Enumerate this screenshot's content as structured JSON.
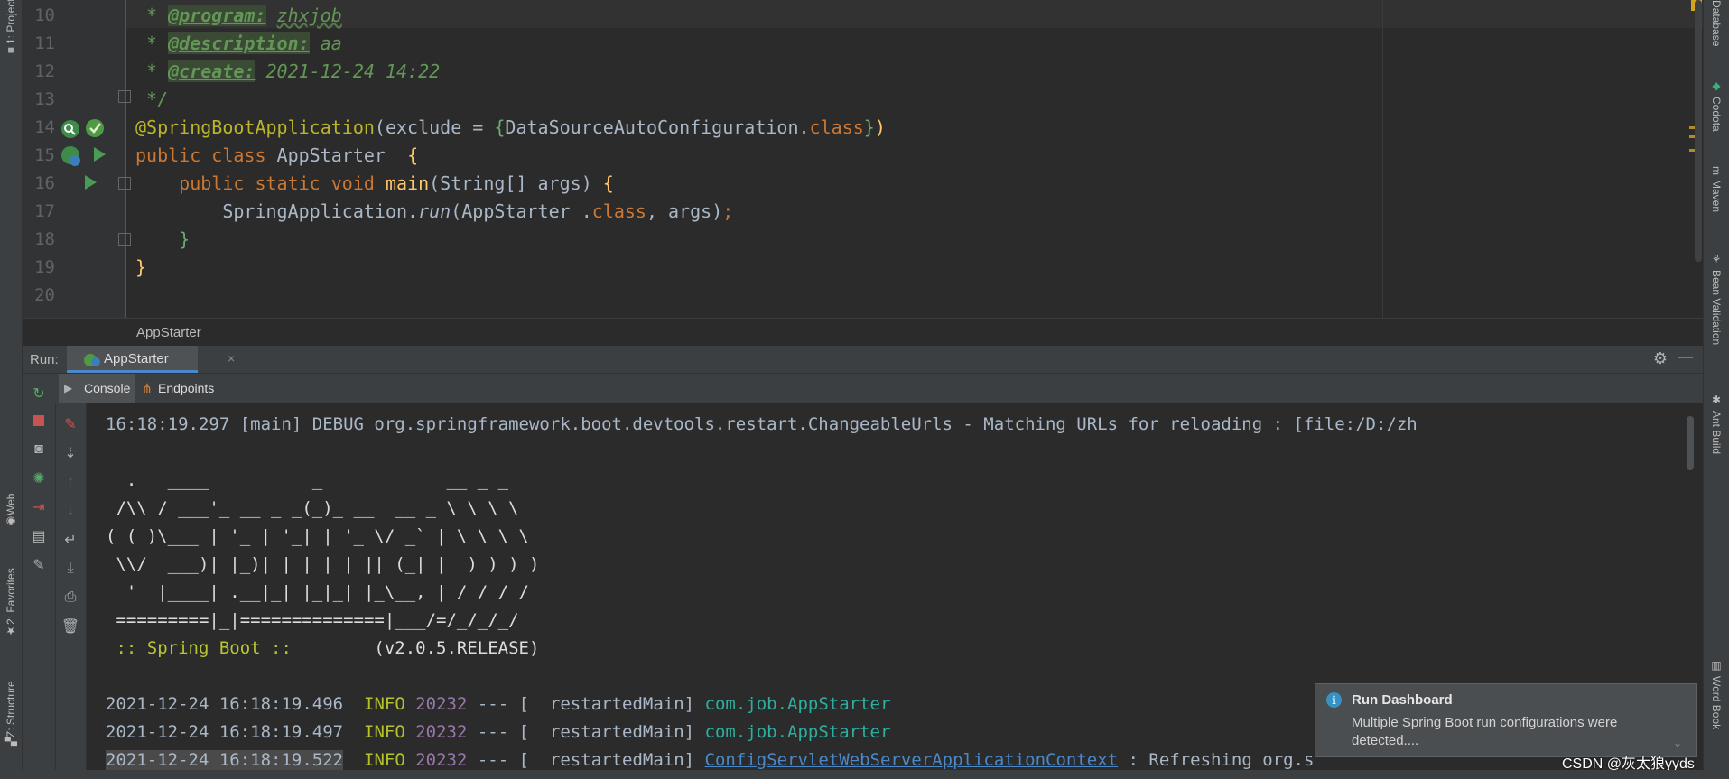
{
  "left_tools": [
    {
      "label": "1: Project",
      "icon": "folder-icon"
    },
    {
      "label": "Web",
      "icon": "globe-icon"
    },
    {
      "label": "2: Favorites",
      "icon": "star-icon"
    },
    {
      "label": "Z: Structure",
      "icon": "structure-icon"
    }
  ],
  "right_tools": [
    {
      "label": "Database",
      "icon": "database-icon"
    },
    {
      "label": "Codota",
      "icon": "codota-icon"
    },
    {
      "label": "Maven",
      "icon": "maven-icon"
    },
    {
      "label": "Bean Validation",
      "icon": "bean-icon"
    },
    {
      "label": "Ant Build",
      "icon": "ant-icon"
    },
    {
      "label": "Word Book",
      "icon": "book-icon"
    }
  ],
  "editor": {
    "line_numbers": [
      "10",
      "11",
      "12",
      "13",
      "14",
      "15",
      "16",
      "17",
      "18",
      "19",
      "20"
    ],
    "comment_program": {
      "star": " * ",
      "tag": "@program:",
      "value": "zhxjob"
    },
    "comment_description": {
      "star": " * ",
      "tag": "@description:",
      "value": "aa"
    },
    "comment_create": {
      "star": " * ",
      "tag": "@create:",
      "value": "2021-12-24 14:22"
    },
    "comment_end": " */",
    "annotation": "@SpringBootApplication",
    "annotation_args": "(exclude = ",
    "annotation_brace_open": "{",
    "annotation_class": "DataSourceAutoConfiguration.",
    "annotation_class_kw": "class",
    "annotation_brace_close": "}",
    "annotation_paren_close": ")",
    "class_decl_kw": "public class ",
    "class_name": "AppStarter",
    "class_open": "{",
    "main_kw": "public static void ",
    "main_name": "main",
    "main_params": "(String[] args) ",
    "main_open": "{",
    "run_target": "SpringApplication.",
    "run_method": "run",
    "run_args_1": "(AppStarter .",
    "run_args_class": "class",
    "run_args_2": ", args)",
    "run_semicolon": ";",
    "inner_close": "}",
    "outer_close": "}",
    "breadcrumb": "AppStarter"
  },
  "run_panel": {
    "title": "Run:",
    "tab_label": "AppStarter",
    "tab_close": "×",
    "console_tab": "Console",
    "endpoints_tab": "Endpoints",
    "settings_icon": "⚙",
    "minimize_icon": "—"
  },
  "console": {
    "debug_line": "16:18:19.297 [main] DEBUG org.springframework.boot.devtools.restart.ChangeableUrls - Matching URLs for reloading : [file:/D:/zh",
    "banner": [
      "  .   ____          _            __ _ _",
      " /\\\\ / ___'_ __ _ _(_)_ __  __ _ \\ \\ \\ \\",
      "( ( )\\___ | '_ | '_| | '_ \\/ _` | \\ \\ \\ \\",
      " \\\\/  ___)| |_)| | | | | || (_| |  ) ) ) )",
      "  '  |____| .__|_| |_|_| |_\\__, | / / / /",
      " =========|_|==============|___/=/_/_/_/"
    ],
    "spring_label": " :: Spring Boot :: ",
    "spring_version": "       (v2.0.5.RELEASE)",
    "log_lines": [
      {
        "ts": "2021-12-24 16:18:19.496",
        "level": "INFO",
        "pid": "20232",
        "sep": " --- [  restartedMain] ",
        "logger": "com.job.AppStarter",
        "msg": ""
      },
      {
        "ts": "2021-12-24 16:18:19.497",
        "level": "INFO",
        "pid": "20232",
        "sep": " --- [  restartedMain] ",
        "logger": "com.job.AppStarter",
        "msg": ""
      },
      {
        "ts": "2021-12-24 16:18:19.522",
        "level": "INFO",
        "pid": "20232",
        "sep": " --- [  restartedMain] ",
        "logger": "ConfigServletWebServerApplicationContext",
        "msg": " : Refreshing org.s"
      }
    ]
  },
  "notification": {
    "title": "Run Dashboard",
    "body": "Multiple Spring Boot run configurations were detected....",
    "chevron": "⌄"
  },
  "watermark": "CSDN @灰太狼yyds"
}
